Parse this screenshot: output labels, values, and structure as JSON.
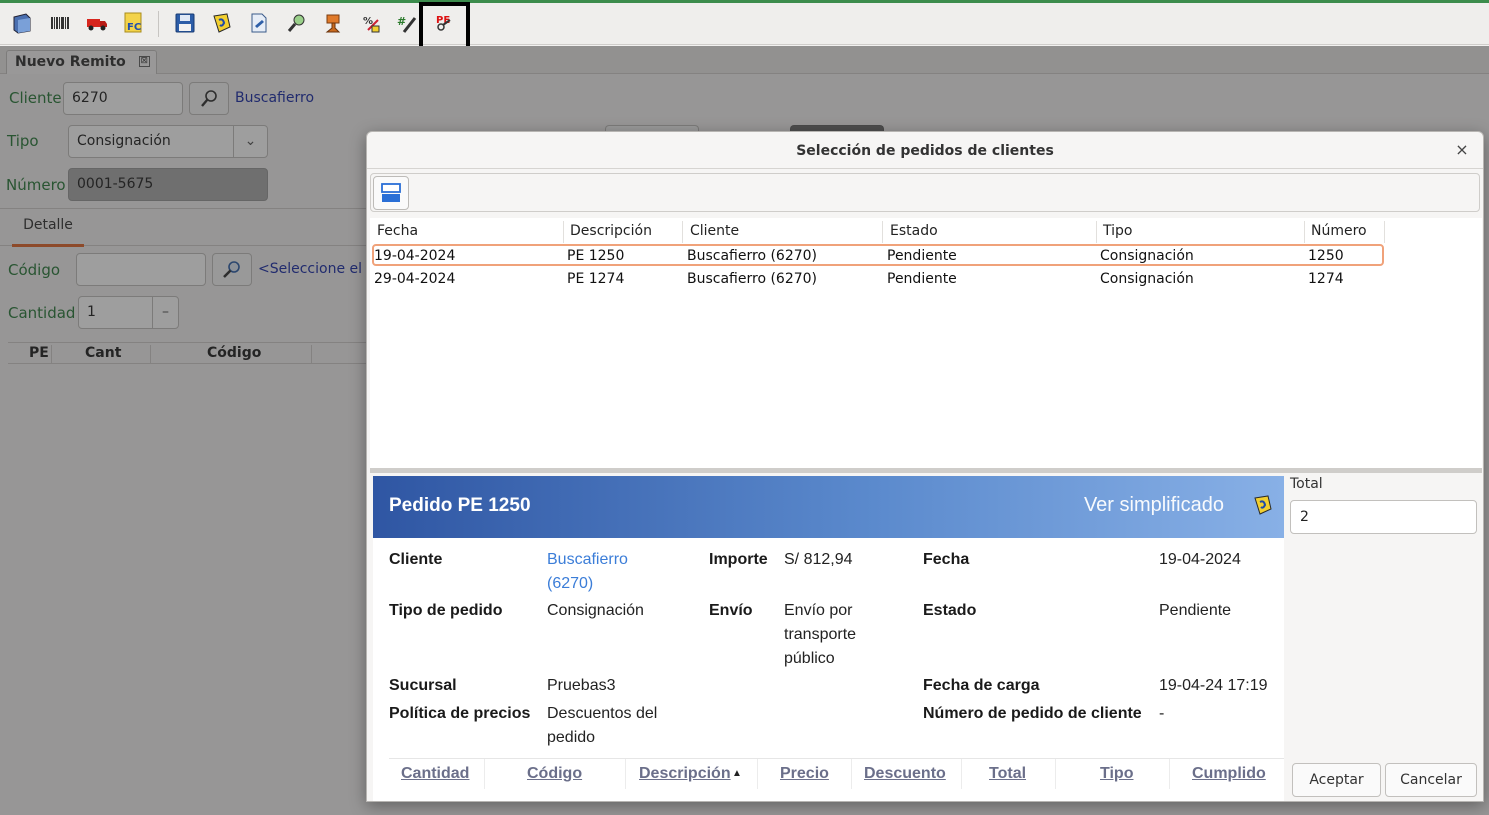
{
  "tab": {
    "title": "Nuevo Remito",
    "close": "⊠"
  },
  "form": {
    "cliente_label": "Cliente",
    "cliente_value": "6270",
    "cliente_name": "Buscafierro",
    "tipo_label": "Tipo",
    "tipo_value": "Consignación",
    "numero_label": "Número",
    "numero_value": "0001-5675",
    "detalle_tab": "Detalle",
    "codigo_label": "Código",
    "codigo_hint": "<Seleccione el li",
    "cantidad_label": "Cantidad",
    "cantidad_value": "1",
    "cantidad_stepper": "–",
    "grid_headers": [
      "PE",
      "Cant",
      "Código"
    ]
  },
  "toolbar_icons": [
    "book-icon",
    "barcode-icon",
    "truck-icon",
    "fc-invoice-icon",
    "save-icon",
    "yellow-note-icon",
    "document-icon",
    "magnifier-tool-icon",
    "stamp-icon",
    "percent-icon",
    "calculator-edit-icon",
    "pe-search-icon"
  ],
  "dialog": {
    "title": "Selección de pedidos de clientes",
    "close": "×",
    "columns": [
      "Fecha",
      "Descripción",
      "Cliente",
      "Estado",
      "Tipo",
      "Número"
    ],
    "rows": [
      {
        "fecha": "19-04-2024",
        "descripcion": "PE 1250",
        "cliente": "Buscafierro (6270)",
        "estado": "Pendiente",
        "tipo": "Consignación",
        "numero": "1250"
      },
      {
        "fecha": "29-04-2024",
        "descripcion": "PE 1274",
        "cliente": "Buscafierro (6270)",
        "estado": "Pendiente",
        "tipo": "Consignación",
        "numero": "1274"
      }
    ],
    "detail": {
      "title": "Pedido PE 1250",
      "simplified_link": "Ver simplificado",
      "cliente_label": "Cliente",
      "cliente_value_1": "Buscafierro",
      "cliente_value_2": "(6270)",
      "importe_label": "Importe",
      "importe_value": "S/ 812,94",
      "fecha_label": "Fecha",
      "fecha_value": "19-04-2024",
      "tipo_label": "Tipo de pedido",
      "tipo_value": "Consignación",
      "envio_label": "Envío",
      "envio_value_1": "Envío por",
      "envio_value_2": "transporte",
      "envio_value_3": "público",
      "estado_label": "Estado",
      "estado_value": "Pendiente",
      "sucursal_label": "Sucursal",
      "sucursal_value": "Pruebas3",
      "fecha_carga_label": "Fecha de carga",
      "fecha_carga_value": "19-04-24 17:19",
      "politica_label": "Política de precios",
      "politica_value_1": "Descuentos del",
      "politica_value_2": "pedido",
      "numero_cliente_label": "Número de pedido de cliente",
      "numero_cliente_value": "-",
      "item_columns": [
        "Cantidad",
        "Código",
        "Descripción",
        "Precio",
        "Descuento",
        "Total",
        "Tipo",
        "Cumplido"
      ],
      "sort_indicator": "▲"
    },
    "total_label": "Total",
    "total_value": "2",
    "accept_button": "Aceptar",
    "cancel_button": "Cancelar"
  },
  "colors": {
    "accent_orange": "#e0662d",
    "link_blue": "#1c2ea8",
    "label_green": "#2b7a3b",
    "banner_start": "#2f56a3",
    "banner_end": "#88b0e6"
  }
}
